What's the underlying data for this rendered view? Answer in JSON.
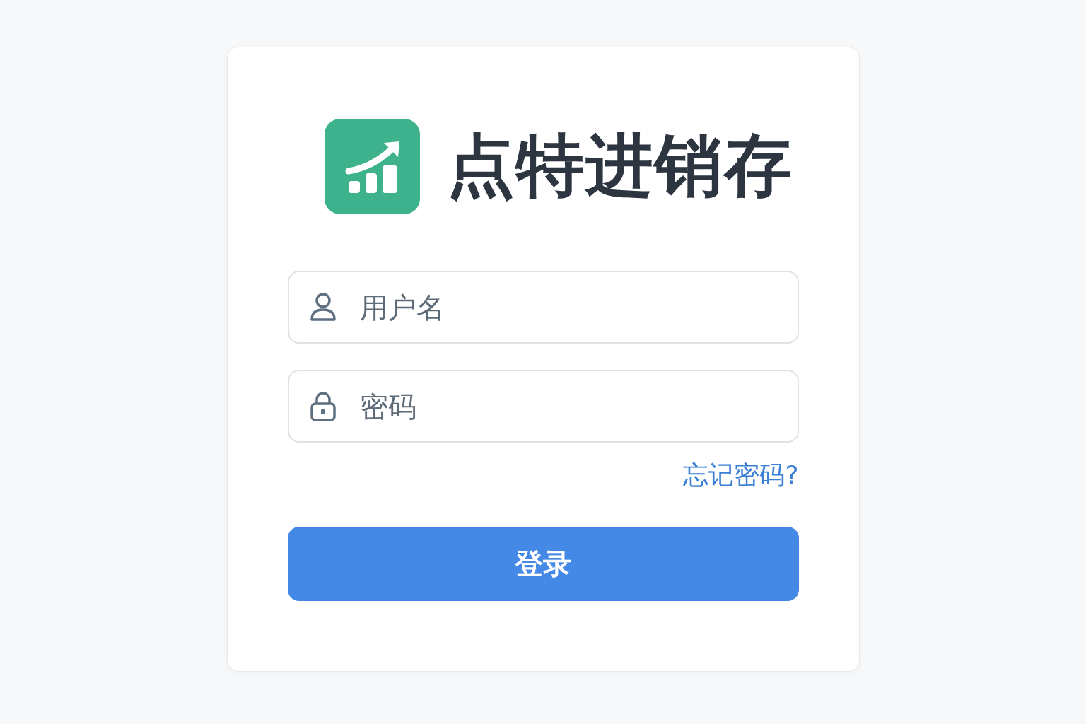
{
  "app": {
    "title": "点特进销存"
  },
  "fields": [
    {
      "kind": "username",
      "placeholder": "用户名"
    },
    {
      "kind": "password",
      "placeholder": "密码"
    }
  ],
  "forgot_link": "忘记密码?",
  "login_button": "登录"
}
